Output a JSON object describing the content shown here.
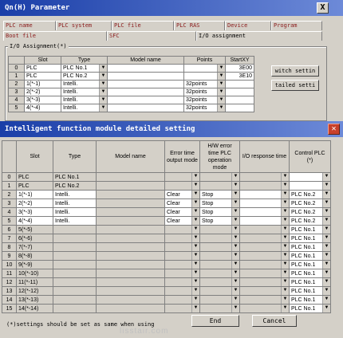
{
  "parameter_window": {
    "title": "Qn(H) Parameter",
    "close": "X",
    "tabs": [
      "PLC name",
      "PLC system",
      "PLC file",
      "PLC RAS",
      "Device",
      "Program",
      "Boot file",
      "SFC",
      "I/O assignment"
    ],
    "active_tab": "I/O assignment",
    "group_label": "I/O Assignment(*)",
    "columns": [
      "Slot",
      "Type",
      "Model name",
      "Points",
      "StartXY"
    ],
    "rows": [
      {
        "num": "0",
        "slot": "PLC",
        "type": "PLC No.1",
        "model": "",
        "points": "",
        "start": "3E00"
      },
      {
        "num": "1",
        "slot": "PLC",
        "type": "PLC No.2",
        "model": "",
        "points": "",
        "start": "3E10"
      },
      {
        "num": "2",
        "slot": "1(*-1)",
        "type": "Intelli.",
        "model": "",
        "points": "32points",
        "start": ""
      },
      {
        "num": "3",
        "slot": "2(*-2)",
        "type": "Intelli.",
        "model": "",
        "points": "32points",
        "start": ""
      },
      {
        "num": "4",
        "slot": "3(*-3)",
        "type": "Intelli.",
        "model": "",
        "points": "32points",
        "start": ""
      },
      {
        "num": "5",
        "slot": "4(*-4)",
        "type": "Intelli.",
        "model": "",
        "points": "32points",
        "start": ""
      }
    ],
    "switch_button": "witch settin",
    "detail_button": "tailed setti"
  },
  "detail_window": {
    "title": "Intelligent function module detailed setting",
    "close": "✕",
    "columns": [
      "Slot",
      "Type",
      "Model name",
      "Error time output mode",
      "H/W error time PLC operation mode",
      "I/O response time",
      "Control PLC (*)"
    ],
    "rows": [
      {
        "num": "0",
        "slot": "PLC",
        "type": "PLC No.1",
        "model": "",
        "err": "",
        "hw": "",
        "io": "",
        "ctrl": ""
      },
      {
        "num": "1",
        "slot": "PLC",
        "type": "PLC No.2",
        "model": "",
        "err": "",
        "hw": "",
        "io": "",
        "ctrl": ""
      },
      {
        "num": "2",
        "slot": "1(*-1)",
        "type": "Intelli.",
        "model": "",
        "err": "Clear",
        "hw": "Stop",
        "io": "",
        "ctrl": "PLC No.2"
      },
      {
        "num": "3",
        "slot": "2(*-2)",
        "type": "Intelli.",
        "model": "",
        "err": "Clear",
        "hw": "Stop",
        "io": "",
        "ctrl": "PLC No.2"
      },
      {
        "num": "4",
        "slot": "3(*-3)",
        "type": "Intelli.",
        "model": "",
        "err": "Clear",
        "hw": "Stop",
        "io": "",
        "ctrl": "PLC No.2"
      },
      {
        "num": "5",
        "slot": "4(*-4)",
        "type": "Intelli.",
        "model": "",
        "err": "Clear",
        "hw": "Stop",
        "io": "",
        "ctrl": "PLC No.2"
      },
      {
        "num": "6",
        "slot": "5(*-5)",
        "type": "",
        "model": "",
        "err": "",
        "hw": "",
        "io": "",
        "ctrl": "PLC No.1"
      },
      {
        "num": "7",
        "slot": "6(*-6)",
        "type": "",
        "model": "",
        "err": "",
        "hw": "",
        "io": "",
        "ctrl": "PLC No.1"
      },
      {
        "num": "8",
        "slot": "7(*-7)",
        "type": "",
        "model": "",
        "err": "",
        "hw": "",
        "io": "",
        "ctrl": "PLC No.1"
      },
      {
        "num": "9",
        "slot": "8(*-8)",
        "type": "",
        "model": "",
        "err": "",
        "hw": "",
        "io": "",
        "ctrl": "PLC No.1"
      },
      {
        "num": "10",
        "slot": "9(*-9)",
        "type": "",
        "model": "",
        "err": "",
        "hw": "",
        "io": "",
        "ctrl": "PLC No.1"
      },
      {
        "num": "11",
        "slot": "10(*-10)",
        "type": "",
        "model": "",
        "err": "",
        "hw": "",
        "io": "",
        "ctrl": "PLC No.1"
      },
      {
        "num": "12",
        "slot": "11(*-11)",
        "type": "",
        "model": "",
        "err": "",
        "hw": "",
        "io": "",
        "ctrl": "PLC No.1"
      },
      {
        "num": "13",
        "slot": "12(*-12)",
        "type": "",
        "model": "",
        "err": "",
        "hw": "",
        "io": "",
        "ctrl": "PLC No.1"
      },
      {
        "num": "14",
        "slot": "13(*-13)",
        "type": "",
        "model": "",
        "err": "",
        "hw": "",
        "io": "",
        "ctrl": "PLC No.1"
      },
      {
        "num": "15",
        "slot": "14(*-14)",
        "type": "",
        "model": "",
        "err": "",
        "hw": "",
        "io": "",
        "ctrl": "PLC No.1"
      }
    ],
    "footnote": "(*)settings should be set as same when using",
    "end_button": "End",
    "cancel_button": "Cancel",
    "watermark": "lisstair.com"
  }
}
